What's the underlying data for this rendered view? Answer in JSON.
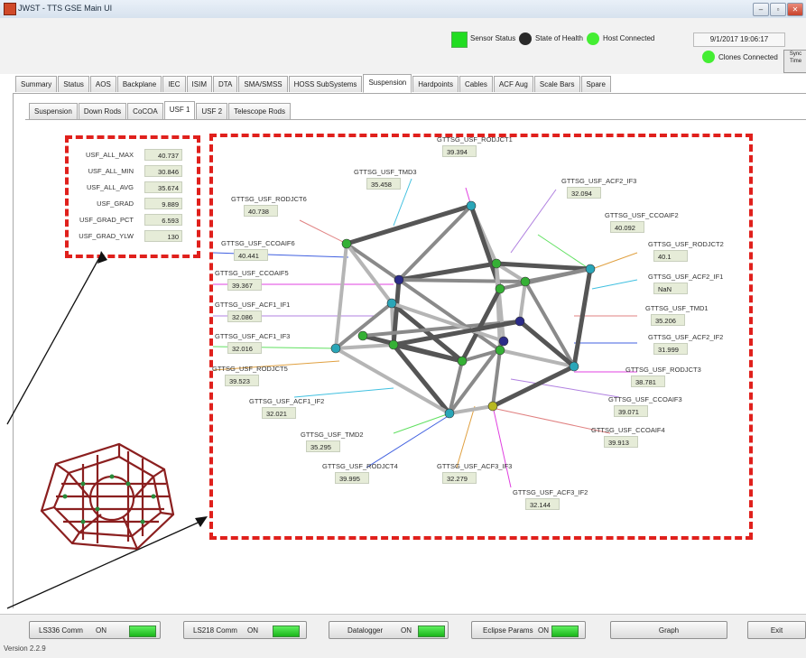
{
  "window": {
    "title": "JWST - TTS GSE Main UI",
    "buttons": [
      "–",
      "▫",
      "✕"
    ]
  },
  "header": {
    "sensor_status_label": "Sensor Status",
    "state_of_health_label": "State of Health",
    "host_connected_label": "Host Connected",
    "datetime": "9/1/2017 19:06:17",
    "clones_connected_label": "Clones Connected",
    "sync_button_label": "Sync Time",
    "colors": {
      "sensor_status": "#22dd22",
      "state_of_health": "#2a2a2a",
      "host_connected": "#44ee33",
      "clones_connected": "#44ee33"
    }
  },
  "main_tabs": [
    "Summary",
    "Status",
    "AOS",
    "Backplane",
    "IEC",
    "ISIM",
    "DTA",
    "SMA/SMSS",
    "HOSS SubSystems",
    "Suspension",
    "Hardpoints",
    "Cables",
    "ACF Aug",
    "Scale Bars",
    "Spare"
  ],
  "main_tab_active": "Suspension",
  "sub_tabs": [
    "Suspension",
    "Down Rods",
    "CoCOA",
    "USF 1",
    "USF 2",
    "Telescope Rods"
  ],
  "sub_tab_active": "USF 1",
  "metrics": [
    {
      "name": "USF_ALL_MAX",
      "value": "40.737"
    },
    {
      "name": "USF_ALL_MIN",
      "value": "30.846"
    },
    {
      "name": "USF_ALL_AVG",
      "value": "35.674"
    },
    {
      "name": "USF_GRAD",
      "value": "9.889"
    },
    {
      "name": "USF_GRAD_PCT",
      "value": "6.593"
    },
    {
      "name": "USF_GRAD_YLW",
      "value": "130"
    }
  ],
  "sensors": [
    {
      "name": "GTTSG_USF_RODJCT1",
      "value": "39.394"
    },
    {
      "name": "GTTSG_USF_TMD3",
      "value": "35.458"
    },
    {
      "name": "GTTSG_USF_ACF2_IF3",
      "value": "32.094"
    },
    {
      "name": "GTTSG_USF_RODJCT6",
      "value": "40.738"
    },
    {
      "name": "GTTSG_USF_CCOAIF2",
      "value": "40.092"
    },
    {
      "name": "GTTSG_USF_CCOAIF6",
      "value": "40.441"
    },
    {
      "name": "GTTSG_USF_RODJCT2",
      "value": "40.1"
    },
    {
      "name": "GTTSG_USF_CCOAIF5",
      "value": "39.367"
    },
    {
      "name": "GTTSG_USF_ACF2_IF1",
      "value": "NaN"
    },
    {
      "name": "GTTSG_USF_ACF1_IF1",
      "value": "32.086"
    },
    {
      "name": "GTTSG_USF_TMD1",
      "value": "35.206"
    },
    {
      "name": "GTTSG_USF_ACF1_IF3",
      "value": "32.016"
    },
    {
      "name": "GTTSG_USF_ACF2_IF2",
      "value": "31.999"
    },
    {
      "name": "GTTSG_USF_RODJCT5",
      "value": "39.523"
    },
    {
      "name": "GTTSG_USF_RODJCT3",
      "value": "38.781"
    },
    {
      "name": "GTTSG_USF_ACF1_IF2",
      "value": "32.021"
    },
    {
      "name": "GTTSG_USF_CCOAIF3",
      "value": "39.071"
    },
    {
      "name": "GTTSG_USF_CCOAIF4",
      "value": "39.913"
    },
    {
      "name": "GTTSG_USF_TMD2",
      "value": "35.295"
    },
    {
      "name": "GTTSG_USF_RODJCT4",
      "value": "39.995"
    },
    {
      "name": "GTTSG_USF_ACF3_IF3",
      "value": "32.279"
    },
    {
      "name": "GTTSG_USF_ACF3_IF2",
      "value": "32.144"
    }
  ],
  "bottom": {
    "ls336_label": "LS336 Comm",
    "ls336_state": "ON",
    "ls218_label": "LS218 Comm",
    "ls218_state": "ON",
    "datalogger_label": "Datalogger",
    "datalogger_state": "ON",
    "eclipse_label": "Eclipse Params",
    "eclipse_state": "ON",
    "graph_label": "Graph",
    "exit_label": "Exit"
  },
  "version": "Version 2.2.9",
  "annotation_color": "#e0201c"
}
